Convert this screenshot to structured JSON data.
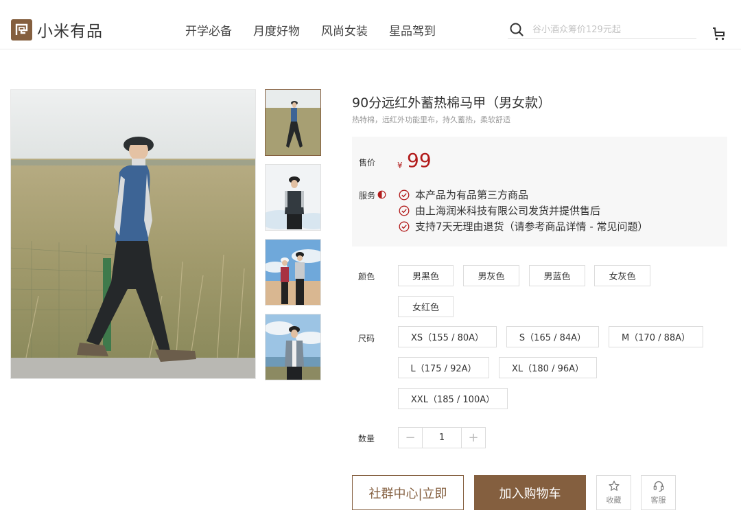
{
  "header": {
    "logo_text": "小米有品",
    "nav": [
      "开学必备",
      "月度好物",
      "风尚女装",
      "星品驾到"
    ],
    "search_placeholder": "谷小酒众筹价129元起"
  },
  "product": {
    "title": "90分远红外蓄热棉马甲（男女款）",
    "subtitle": "热特棉，远红外功能里布，持久蓄热，柔软舒适",
    "price_label": "售价",
    "currency": "¥",
    "price": "99",
    "service_label": "服务",
    "services": [
      "本产品为有品第三方商品",
      "由上海润米科技有限公司发货并提供售后",
      "支持7天无理由退货（请参考商品详情 - 常见问题）"
    ],
    "color_label": "颜色",
    "colors": [
      "男黑色",
      "男灰色",
      "男蓝色",
      "女灰色",
      "女红色"
    ],
    "size_label": "尺码",
    "sizes": [
      "XS（155 / 80A）",
      "S（165 / 84A）",
      "M（170 / 88A）",
      "L（175 / 92A）",
      "XL（180 / 96A）",
      "XXL（185 / 100A）"
    ],
    "qty_label": "数量",
    "qty_minus": "−",
    "qty_value": "1",
    "qty_plus": "+",
    "community_button": "社群中心|立即",
    "cart_button": "加入购物车",
    "favorite_label": "收藏",
    "service_button_label": "客服"
  },
  "colors": {
    "brand": "#845f3f",
    "price": "#b21b1b"
  },
  "icons": [
    "search-icon",
    "cart-icon",
    "check-circle-icon",
    "star-icon",
    "headset-icon"
  ]
}
